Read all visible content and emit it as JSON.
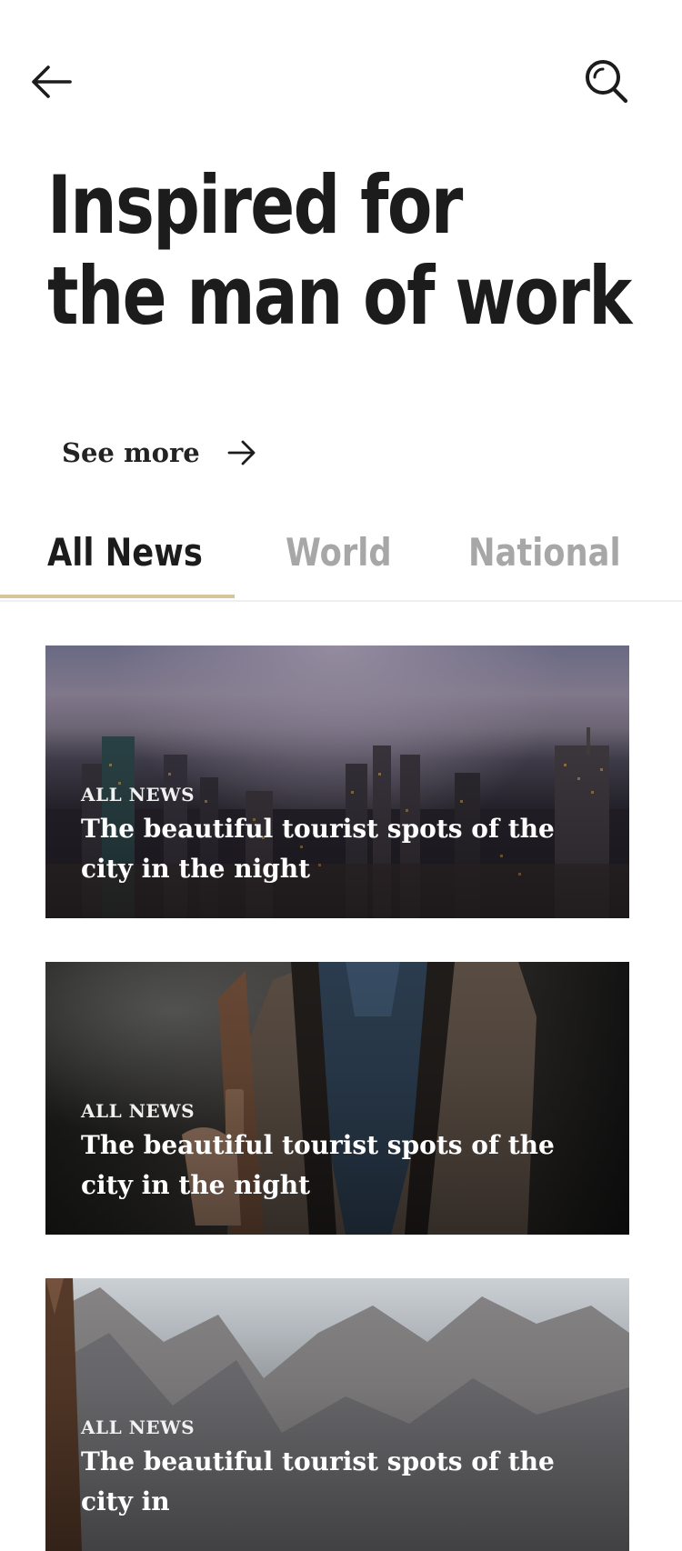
{
  "header": {
    "back_icon": "arrow-left-icon",
    "search_icon": "search-icon"
  },
  "hero": {
    "title_line1": "Inspired for",
    "title_line2": "the man of work",
    "see_more_label": "See more",
    "see_more_icon": "arrow-right-icon"
  },
  "tabs": [
    {
      "label": "All News",
      "active": true
    },
    {
      "label": "World",
      "active": false
    },
    {
      "label": "National",
      "active": false
    }
  ],
  "colors": {
    "accent": "#d8c39d",
    "text_dark": "#1c1c1c",
    "tab_inactive": "#a7a7a7"
  },
  "articles": [
    {
      "category": "ALL NEWS",
      "title": "The beautiful tourist spots of the city in the night"
    },
    {
      "category": "ALL NEWS",
      "title": "The beautiful tourist spots of the city in the night"
    },
    {
      "category": "ALL NEWS",
      "title": "The beautiful tourist spots of the city in"
    }
  ]
}
